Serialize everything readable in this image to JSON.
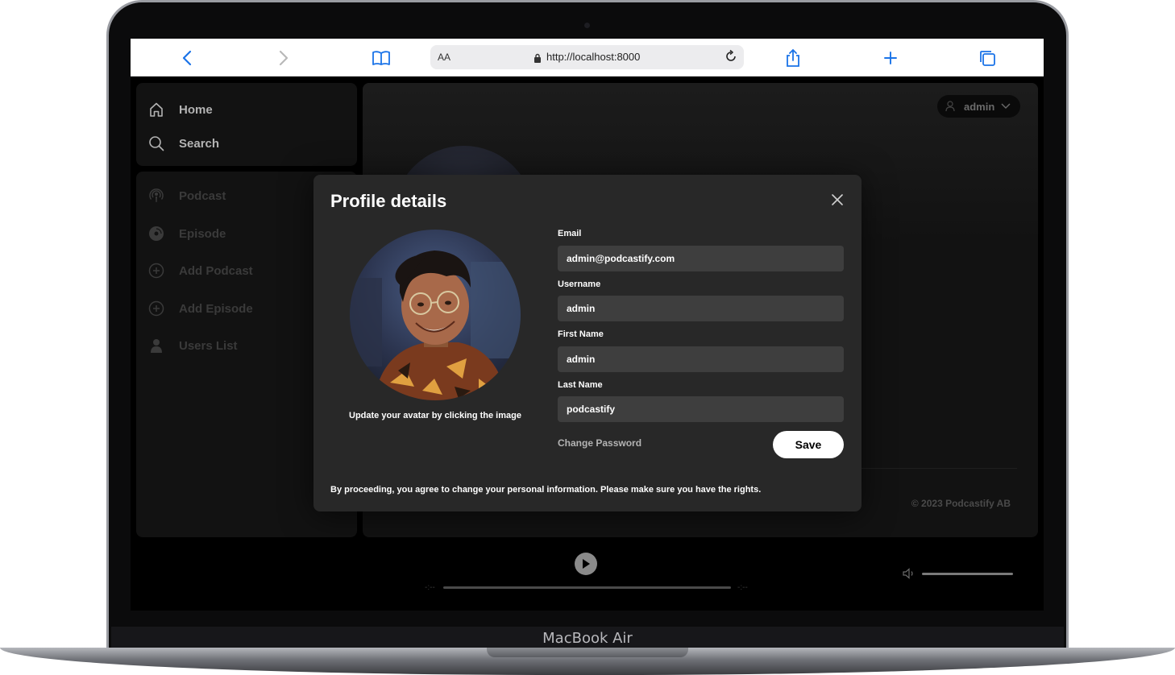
{
  "device": {
    "label": "MacBook Air"
  },
  "browser": {
    "reader_label": "AA",
    "url": "http://localhost:8000"
  },
  "sidebar": {
    "top_items": [
      {
        "label": "Home",
        "icon": "home-icon"
      },
      {
        "label": "Search",
        "icon": "search-icon"
      }
    ],
    "library_items": [
      {
        "label": "Podcast",
        "icon": "podcast-icon"
      },
      {
        "label": "Episode",
        "icon": "disc-icon"
      },
      {
        "label": "Add Podcast",
        "icon": "plus-circle-icon"
      },
      {
        "label": "Add Episode",
        "icon": "plus-circle-icon"
      },
      {
        "label": "Users List",
        "icon": "user-icon"
      }
    ]
  },
  "header": {
    "username": "admin"
  },
  "footer": {
    "copyright": "© 2023 Podcastify AB"
  },
  "modal": {
    "title": "Profile details",
    "avatar_caption": "Update your avatar by clicking the image",
    "fields": {
      "email": {
        "label": "Email",
        "value": "admin@podcastify.com"
      },
      "username": {
        "label": "Username",
        "value": "admin"
      },
      "first_name": {
        "label": "First Name",
        "value": "admin"
      },
      "last_name": {
        "label": "Last Name",
        "value": "podcastify"
      }
    },
    "change_password_label": "Change Password",
    "save_label": "Save",
    "disclaimer": "By proceeding, you agree to change your personal information. Please make sure you have the rights."
  },
  "colors": {
    "app_background": "#000000",
    "panel": "#121212",
    "modal": "#282828",
    "input": "#3e3e3e",
    "accent_link": "#1a73e8"
  }
}
